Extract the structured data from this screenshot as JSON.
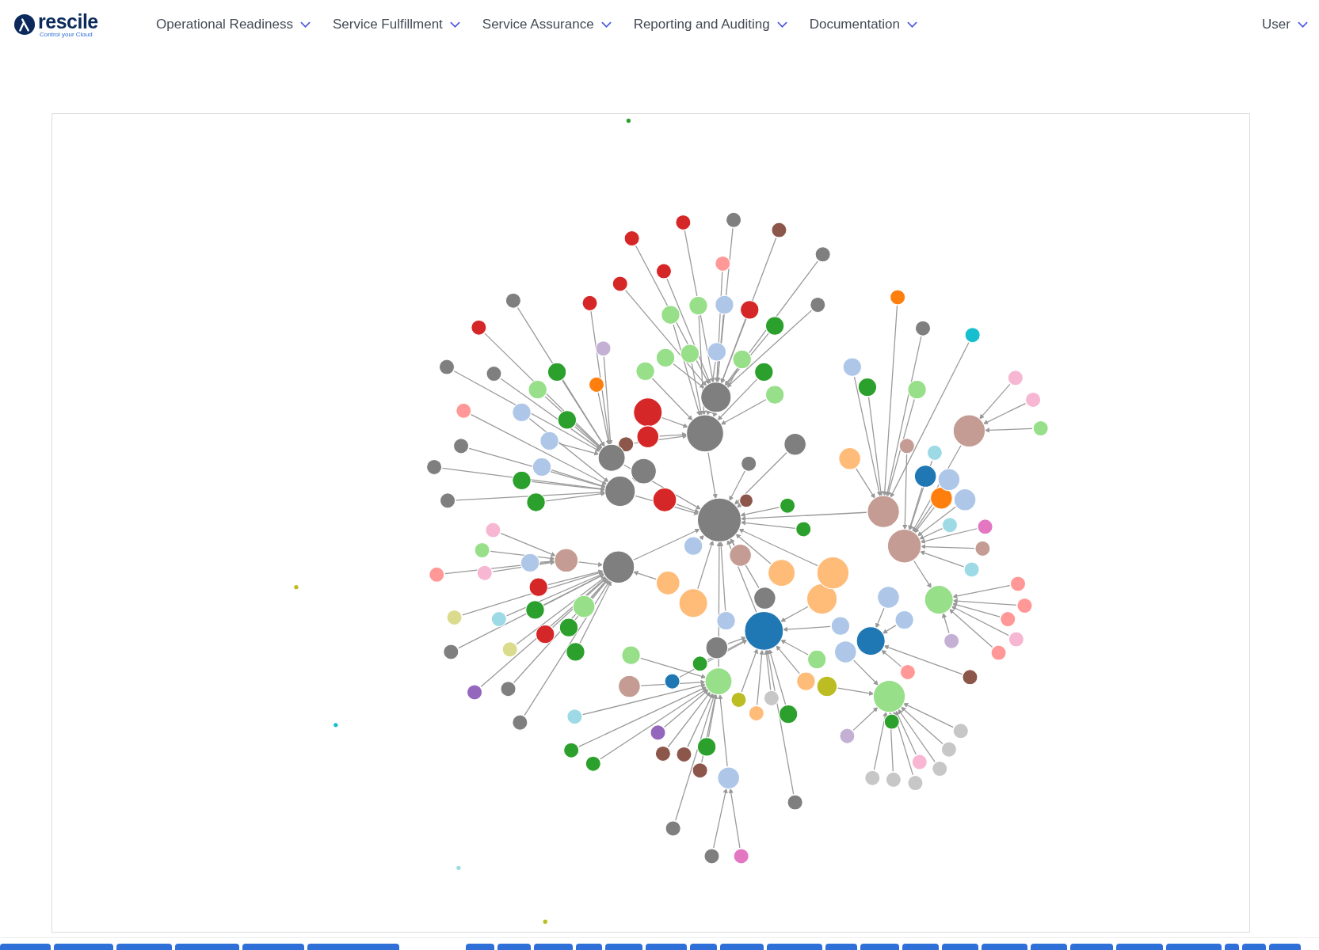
{
  "brand": {
    "name": "rescile",
    "tagline": "Control your Cloud"
  },
  "nav": [
    {
      "label": "Operational Readiness"
    },
    {
      "label": "Service Fulfillment"
    },
    {
      "label": "Service Assurance"
    },
    {
      "label": "Reporting and Auditing"
    },
    {
      "label": "Documentation"
    }
  ],
  "user_menu": {
    "label": "User"
  }
}
